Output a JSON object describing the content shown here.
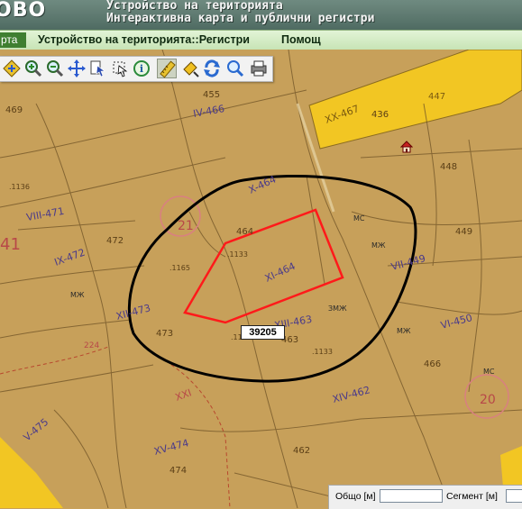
{
  "header": {
    "logo": "ОВО",
    "title_line1": "Устройство на територията",
    "title_line2": "Интерактивна карта и публични регистри"
  },
  "nav": {
    "first_tab_fragment": "рта",
    "items": [
      {
        "label": "Устройство на територията::Регистри"
      },
      {
        "label": "Помощ"
      }
    ]
  },
  "toolbar": {
    "tools": [
      {
        "icon": "pan-icon"
      },
      {
        "icon": "zoom-in-icon"
      },
      {
        "icon": "zoom-out-icon"
      },
      {
        "icon": "full-extent-icon"
      },
      {
        "icon": "identify-icon"
      },
      {
        "icon": "select-icon"
      },
      {
        "icon": "info-icon"
      },
      {
        "icon": "measure-icon",
        "active": true
      },
      {
        "icon": "clear-icon"
      },
      {
        "icon": "refresh-icon"
      },
      {
        "icon": "search-icon"
      },
      {
        "icon": "print-icon"
      }
    ]
  },
  "map": {
    "parcel_label": "39205",
    "labels": [
      "455",
      "IV-466",
      "XX-467",
      "447",
      "448",
      "XII-466",
      "VIII-471",
      "472",
      "IX-472",
      "X-464",
      "21",
      "464",
      "XI-464",
      "XII-473",
      "473",
      "449",
      "VII-449",
      "VI-450",
      "463",
      "XIII-463",
      "XIV-462",
      "XXI",
      "20",
      "V-475",
      "XV-474",
      "462",
      "474",
      "41",
      "1128",
      "1133",
      "1165",
      "1137",
      "1136",
      "МЖ",
      "МС",
      "ЗМЖ",
      "224"
    ],
    "colors": {
      "background": "#c9a15a",
      "highlight_polygon": "#ff1a1a",
      "buffer": "#000000",
      "yellow_parcel": "#f2c623"
    }
  },
  "status": {
    "total_label": "Общо [м]",
    "total_value": "",
    "segment_label": "Сегмент [м]",
    "segment_value": ""
  }
}
